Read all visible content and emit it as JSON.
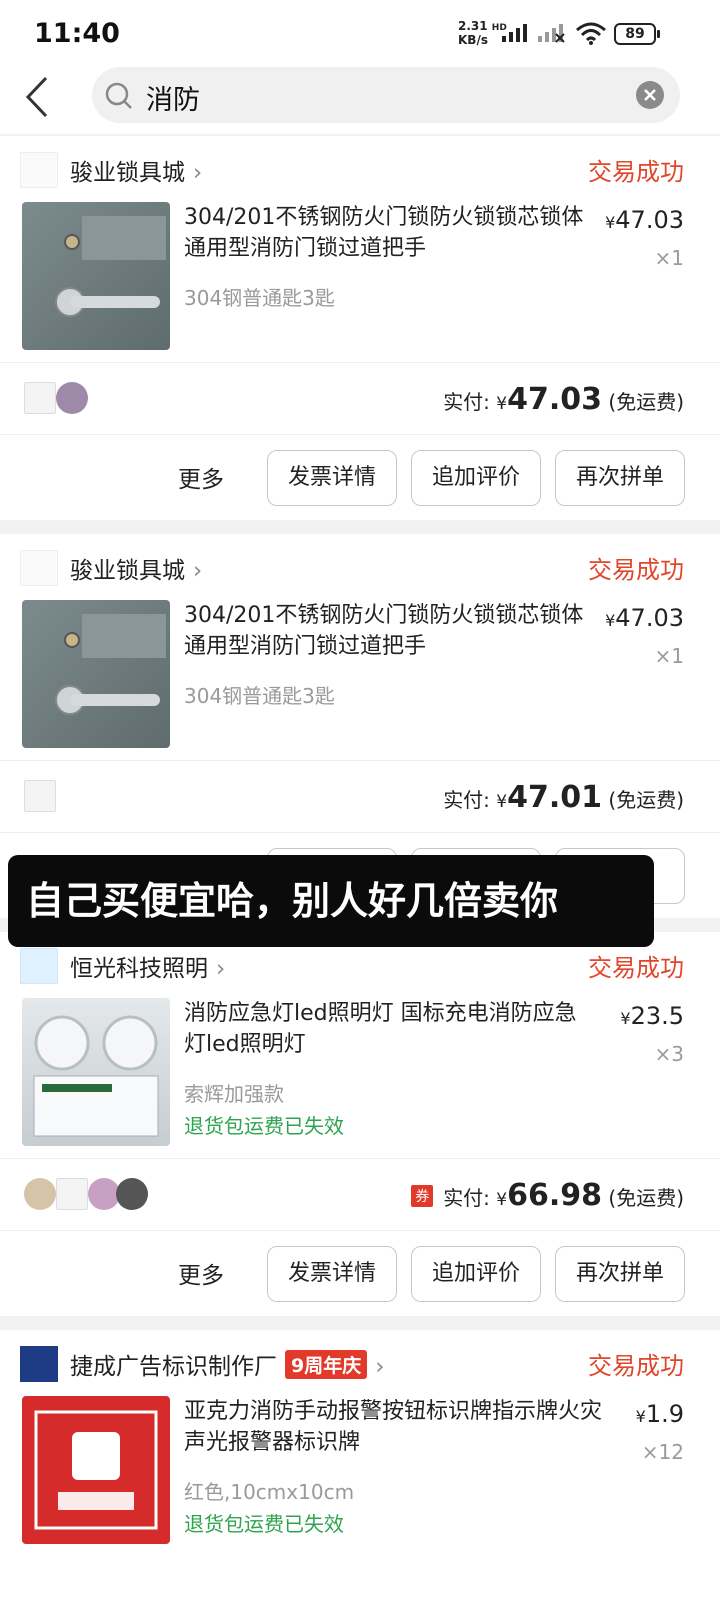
{
  "status_bar": {
    "time": "11:40",
    "net_speed_value": "2.31",
    "net_speed_unit": "KB/s",
    "network_type": "HD",
    "battery": "89"
  },
  "search": {
    "query": "消防"
  },
  "orders": [
    {
      "shop": "骏业锁具城",
      "status": "交易成功",
      "title": "304/201不锈钢防火门锁防火锁锁芯锁体通用型消防门锁过道把手",
      "sku": "304钢普通匙3匙",
      "price_symbol": "¥",
      "price": "47.03",
      "qty": "×1",
      "paid_label": "实付:",
      "paid_symbol": "¥",
      "paid_amount": "47.03",
      "shipping": "(免运费)",
      "more": "更多",
      "buttons": [
        "发票详情",
        "追加评价",
        "再次拼单"
      ]
    },
    {
      "shop": "骏业锁具城",
      "status": "交易成功",
      "title": "304/201不锈钢防火门锁防火锁锁芯锁体通用型消防门锁过道把手",
      "sku": "304钢普通匙3匙",
      "price_symbol": "¥",
      "price": "47.03",
      "qty": "×1",
      "paid_label": "实付:",
      "paid_symbol": "¥",
      "paid_amount": "47.01",
      "shipping": "(免运费)"
    },
    {
      "shop": "恒光科技照明",
      "status": "交易成功",
      "title": "消防应急灯led照明灯 国标充电消防应急灯led照明灯",
      "sku": "索辉加强款",
      "notice": "退货包运费已失效",
      "price_symbol": "¥",
      "price": "23.5",
      "qty": "×3",
      "coupon": "券",
      "paid_label": "实付:",
      "paid_symbol": "¥",
      "paid_amount": "66.98",
      "shipping": "(免运费)",
      "more": "更多",
      "buttons": [
        "发票详情",
        "追加评价",
        "再次拼单"
      ]
    },
    {
      "shop": "捷成广告标识制作厂",
      "promo": "9周年庆",
      "status": "交易成功",
      "title": "亚克力消防手动报警按钮标识牌指示牌火灾声光报警器标识牌",
      "sku": "红色,10cmx10cm",
      "notice": "退货包运费已失效",
      "price_symbol": "¥",
      "price": "1.9",
      "qty": "×12"
    }
  ],
  "overlay_caption": "自己买便宜哈，别人好几倍卖你",
  "colors": {
    "status_success": "#e2462a",
    "warn_green": "#2ea44f",
    "coupon_red": "#e23a2a"
  },
  "icons": [
    "back-arrow-icon",
    "search-icon",
    "clear-icon",
    "chevron-right-icon",
    "wifi-icon",
    "signal-icon"
  ]
}
